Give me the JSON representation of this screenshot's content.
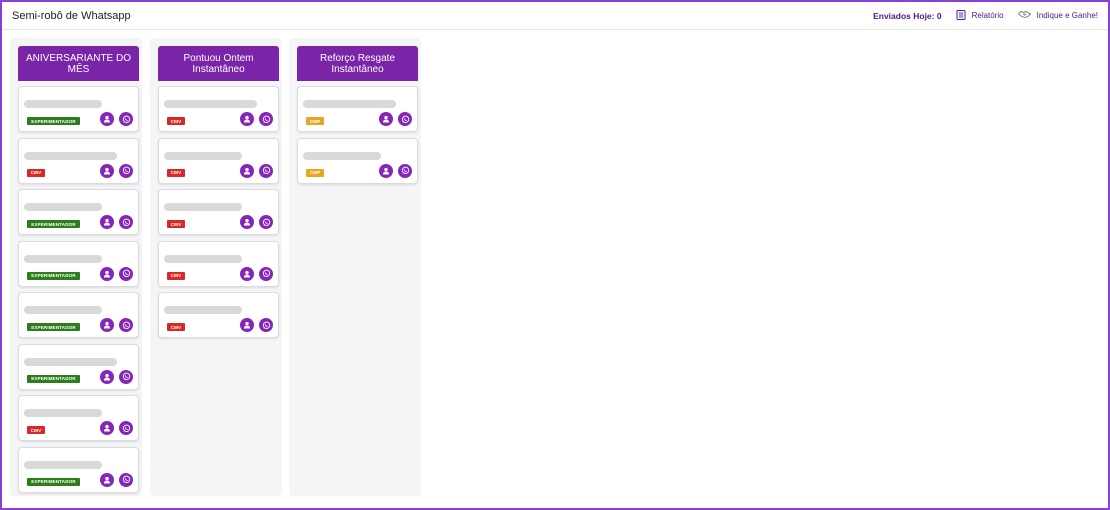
{
  "header": {
    "title": "Semi-robô de Whatsapp",
    "sent_today": "Enviados Hoje: 0",
    "report_label": "Relatório",
    "refer_label": "Indique e Ganhe!"
  },
  "colors": {
    "brand_purple": "#7a24a8",
    "badge_experimentador": "#2d7d1a",
    "badge_cmv": "#d92828",
    "badge_cmp": "#e6a523"
  },
  "columns": [
    {
      "title": "ANIVERSARIANTE DO MÊS",
      "cards": [
        {
          "badge": "EXPERIMENTADOR",
          "badge_type": "exp"
        },
        {
          "badge": "CMV",
          "badge_type": "cmv"
        },
        {
          "badge": "EXPERIMENTADOR",
          "badge_type": "exp"
        },
        {
          "badge": "EXPERIMENTADOR",
          "badge_type": "exp"
        },
        {
          "badge": "EXPERIMENTADOR",
          "badge_type": "exp"
        },
        {
          "badge": "EXPERIMENTADOR",
          "badge_type": "exp"
        },
        {
          "badge": "CMV",
          "badge_type": "cmv"
        },
        {
          "badge": "EXPERIMENTADOR",
          "badge_type": "exp"
        }
      ]
    },
    {
      "title": "Pontuou Ontem Instantâneo",
      "cards": [
        {
          "badge": "CMV",
          "badge_type": "cmv"
        },
        {
          "badge": "CMV",
          "badge_type": "cmv"
        },
        {
          "badge": "CMV",
          "badge_type": "cmv"
        },
        {
          "badge": "CMV",
          "badge_type": "cmv"
        },
        {
          "badge": "CMV",
          "badge_type": "cmv"
        }
      ]
    },
    {
      "title": "Reforço Resgate Instantâneo",
      "cards": [
        {
          "badge": "CMP",
          "badge_type": "cmp"
        },
        {
          "badge": "CMP",
          "badge_type": "cmp"
        }
      ]
    }
  ],
  "icons": {
    "report": "document-list-icon",
    "refer": "handshake-icon",
    "contact": "user-icon",
    "whatsapp": "whatsapp-icon"
  }
}
